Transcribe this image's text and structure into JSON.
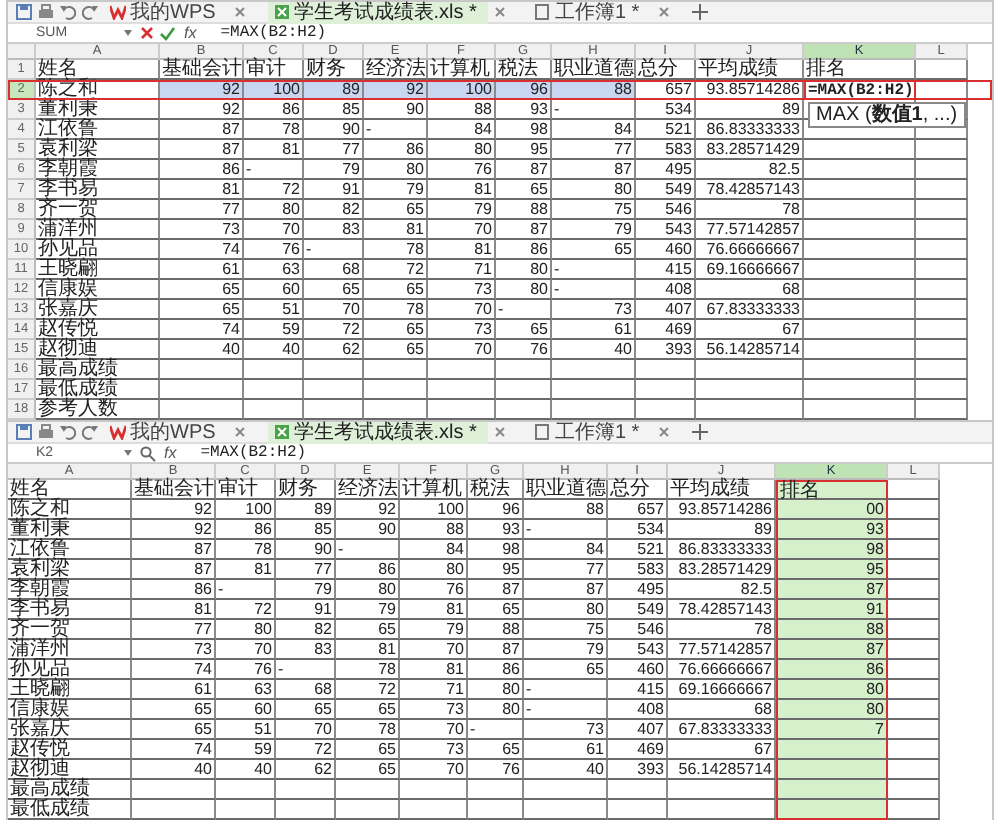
{
  "windows": [
    {
      "tabs": [
        {
          "label": "我的WPS",
          "kind": "home",
          "selected": false
        },
        {
          "label": "学生考试成绩表.xls *",
          "kind": "sheet",
          "selected": true
        },
        {
          "label": "工作簿1 *",
          "kind": "doc",
          "selected": false
        }
      ],
      "name_box": "SUM",
      "editing": true,
      "fx_label": "fx",
      "formula": "=MAX(B2:H2)",
      "tooltip": "MAX (**数值1**, ...)",
      "columns": [
        {
          "letter": "A",
          "selected": false
        },
        {
          "letter": "B",
          "selected": false
        },
        {
          "letter": "C",
          "selected": false
        },
        {
          "letter": "D",
          "selected": false
        },
        {
          "letter": "E",
          "selected": false
        },
        {
          "letter": "F",
          "selected": false
        },
        {
          "letter": "G",
          "selected": false
        },
        {
          "letter": "H",
          "selected": false
        },
        {
          "letter": "I",
          "selected": false
        },
        {
          "letter": "J",
          "selected": false
        },
        {
          "letter": "K",
          "selected": true
        },
        {
          "letter": "L",
          "selected": false
        }
      ],
      "rows": [
        {
          "number": "1",
          "selected": false,
          "cells": [
            "姓名",
            "基础会计",
            "审计",
            "财务",
            "经济法",
            "计算机",
            "税法",
            "职业道德",
            "总分",
            "平均成绩",
            "排名"
          ]
        },
        {
          "number": "2",
          "selected": true,
          "cells": [
            "陈之和",
            "92",
            "100",
            "89",
            "92",
            "100",
            "96",
            "88",
            "657",
            "93.85714286",
            "=MAX(B2:H2)"
          ]
        },
        {
          "number": "3",
          "selected": false,
          "cells": [
            "董利秉",
            "92",
            "86",
            "85",
            "90",
            "88",
            "93",
            "-",
            "534",
            "89"
          ]
        },
        {
          "number": "4",
          "selected": false,
          "cells": [
            "江依鲁",
            "87",
            "78",
            "90",
            "-",
            "84",
            "98",
            "84",
            "521",
            "86.83333333"
          ]
        },
        {
          "number": "5",
          "selected": false,
          "cells": [
            "袁利梁",
            "87",
            "81",
            "77",
            "86",
            "80",
            "95",
            "77",
            "583",
            "83.28571429"
          ]
        },
        {
          "number": "6",
          "selected": false,
          "cells": [
            "李朝霞",
            "86",
            "-",
            "79",
            "80",
            "76",
            "87",
            "87",
            "495",
            "82.5"
          ]
        },
        {
          "number": "7",
          "selected": false,
          "cells": [
            "李书易",
            "81",
            "72",
            "91",
            "79",
            "81",
            "65",
            "80",
            "549",
            "78.42857143"
          ]
        },
        {
          "number": "8",
          "selected": false,
          "cells": [
            "齐一贺",
            "77",
            "80",
            "82",
            "65",
            "79",
            "88",
            "75",
            "546",
            "78"
          ]
        },
        {
          "number": "9",
          "selected": false,
          "cells": [
            "蒲洋州",
            "73",
            "70",
            "83",
            "81",
            "70",
            "87",
            "79",
            "543",
            "77.57142857"
          ]
        },
        {
          "number": "10",
          "selected": false,
          "cells": [
            "孙见品",
            "74",
            "76",
            "-",
            "78",
            "81",
            "86",
            "65",
            "460",
            "76.66666667"
          ]
        },
        {
          "number": "11",
          "selected": false,
          "cells": [
            "王晓翩",
            "61",
            "63",
            "68",
            "72",
            "71",
            "80",
            "-",
            "415",
            "69.16666667"
          ]
        },
        {
          "number": "12",
          "selected": false,
          "cells": [
            "信康娱",
            "65",
            "60",
            "65",
            "65",
            "73",
            "80",
            "-",
            "408",
            "68"
          ]
        },
        {
          "number": "13",
          "selected": false,
          "cells": [
            "张嘉庆",
            "65",
            "51",
            "70",
            "78",
            "70",
            "-",
            "73",
            "407",
            "67.83333333"
          ]
        },
        {
          "number": "14",
          "selected": false,
          "cells": [
            "赵传悦",
            "74",
            "59",
            "72",
            "65",
            "73",
            "65",
            "61",
            "469",
            "67"
          ]
        },
        {
          "number": "15",
          "selected": false,
          "cells": [
            "赵彻迪",
            "40",
            "40",
            "62",
            "65",
            "70",
            "76",
            "40",
            "393",
            "56.14285714"
          ]
        },
        {
          "number": "16",
          "selected": false,
          "cells": [
            "最高成绩"
          ]
        },
        {
          "number": "17",
          "selected": false,
          "cells": [
            "最低成绩"
          ]
        },
        {
          "number": "18",
          "selected": false,
          "cells": [
            "参考人数"
          ]
        }
      ]
    },
    {
      "tabs": [
        {
          "label": "我的WPS",
          "kind": "home",
          "selected": false
        },
        {
          "label": "学生考试成绩表.xls *",
          "kind": "sheet",
          "selected": true
        },
        {
          "label": "工作簿1 *",
          "kind": "doc",
          "selected": false
        }
      ],
      "name_box": "K2",
      "editing": false,
      "fx_label": "fx",
      "formula": "=MAX(B2:H2)",
      "columns": [
        {
          "letter": "A",
          "selected": false
        },
        {
          "letter": "B",
          "selected": false
        },
        {
          "letter": "C",
          "selected": false
        },
        {
          "letter": "D",
          "selected": false
        },
        {
          "letter": "E",
          "selected": false
        },
        {
          "letter": "F",
          "selected": false
        },
        {
          "letter": "G",
          "selected": false
        },
        {
          "letter": "H",
          "selected": false
        },
        {
          "letter": "I",
          "selected": false
        },
        {
          "letter": "J",
          "selected": false
        },
        {
          "letter": "K",
          "selected": true,
          "filled": true,
          "outlined": true
        },
        {
          "letter": "L",
          "selected": false
        }
      ],
      "rows": [
        {
          "selected": false,
          "cells": [
            "姓名",
            "基础会计",
            "审计",
            "财务",
            "经济法",
            "计算机",
            "税法",
            "职业道德",
            "总分",
            "平均成绩",
            "排名"
          ]
        },
        {
          "selected": false,
          "cells": [
            "陈之和",
            "92",
            "100",
            "89",
            "92",
            "100",
            "96",
            "88",
            "657",
            "93.85714286",
            "00"
          ]
        },
        {
          "selected": false,
          "cells": [
            "董利秉",
            "92",
            "86",
            "85",
            "90",
            "88",
            "93",
            "-",
            "534",
            "89",
            "93"
          ]
        },
        {
          "selected": false,
          "cells": [
            "江依鲁",
            "87",
            "78",
            "90",
            "-",
            "84",
            "98",
            "84",
            "521",
            "86.83333333",
            "98"
          ]
        },
        {
          "selected": false,
          "cells": [
            "袁利梁",
            "87",
            "81",
            "77",
            "86",
            "80",
            "95",
            "77",
            "583",
            "83.28571429",
            "95"
          ]
        },
        {
          "selected": false,
          "cells": [
            "李朝霞",
            "86",
            "-",
            "79",
            "80",
            "76",
            "87",
            "87",
            "495",
            "82.5",
            "87"
          ]
        },
        {
          "selected": false,
          "cells": [
            "李书易",
            "81",
            "72",
            "91",
            "79",
            "81",
            "65",
            "80",
            "549",
            "78.42857143",
            "91"
          ]
        },
        {
          "selected": false,
          "cells": [
            "齐一贺",
            "77",
            "80",
            "82",
            "65",
            "79",
            "88",
            "75",
            "546",
            "78",
            "88"
          ]
        },
        {
          "selected": false,
          "cells": [
            "蒲洋州",
            "73",
            "70",
            "83",
            "81",
            "70",
            "87",
            "79",
            "543",
            "77.57142857",
            "87"
          ]
        },
        {
          "selected": false,
          "cells": [
            "孙见品",
            "74",
            "76",
            "-",
            "78",
            "81",
            "86",
            "65",
            "460",
            "76.66666667",
            "86"
          ]
        },
        {
          "selected": false,
          "cells": [
            "王晓翩",
            "61",
            "63",
            "68",
            "72",
            "71",
            "80",
            "-",
            "415",
            "69.16666667",
            "80"
          ]
        },
        {
          "selected": false,
          "cells": [
            "信康娱",
            "65",
            "60",
            "65",
            "65",
            "73",
            "80",
            "-",
            "408",
            "68",
            "80"
          ]
        },
        {
          "selected": false,
          "cells": [
            "张嘉庆",
            "65",
            "51",
            "70",
            "78",
            "70",
            "-",
            "73",
            "407",
            "67.83333333",
            "7"
          ]
        },
        {
          "selected": false,
          "cells": [
            "赵传悦",
            "74",
            "59",
            "72",
            "65",
            "73",
            "65",
            "61",
            "469",
            "67"
          ]
        },
        {
          "selected": false,
          "cells": [
            "赵彻迪",
            "40",
            "40",
            "62",
            "65",
            "70",
            "76",
            "40",
            "393",
            "56.14285714"
          ]
        },
        {
          "selected": false,
          "cells": [
            "最高成绩"
          ]
        },
        {
          "selected": false,
          "cells": [
            "最低成绩"
          ]
        }
      ]
    }
  ]
}
